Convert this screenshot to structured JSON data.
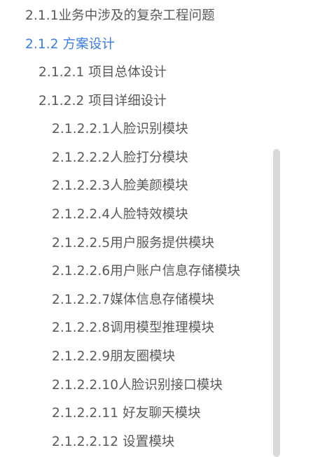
{
  "toc": {
    "items": [
      {
        "label": "2.1.1业务中涉及的复杂工程问题",
        "active": false
      },
      {
        "label": "2.1.2 方案设计",
        "active": true
      },
      {
        "label": "2.1.2.1 项目总体设计",
        "active": false
      },
      {
        "label": "2.1.2.2 项目详细设计",
        "active": false
      },
      {
        "label": "2.1.2.2.1人脸识别模块",
        "active": false
      },
      {
        "label": "2.1.2.2.2人脸打分模块",
        "active": false
      },
      {
        "label": "2.1.2.2.3人脸美颜模块",
        "active": false
      },
      {
        "label": "2.1.2.2.4人脸特效模块",
        "active": false
      },
      {
        "label": "2.1.2.2.5用户服务提供模块",
        "active": false
      },
      {
        "label": "2.1.2.2.6用户账户信息存储模块",
        "active": false
      },
      {
        "label": "2.1.2.2.7媒体信息存储模块",
        "active": false
      },
      {
        "label": "2.1.2.2.8调用模型推理模块",
        "active": false
      },
      {
        "label": "2.1.2.2.9朋友圈模块",
        "active": false
      },
      {
        "label": "2.1.2.2.10人脸识别接口模块",
        "active": false
      },
      {
        "label": "2.1.2.2.11 好友聊天模块",
        "active": false
      },
      {
        "label": "2.1.2.2.12 设置模块",
        "active": false
      }
    ]
  },
  "colors": {
    "text": "#595959",
    "active": "#3b7ddd",
    "scrollbar": "#d9d9d9"
  }
}
